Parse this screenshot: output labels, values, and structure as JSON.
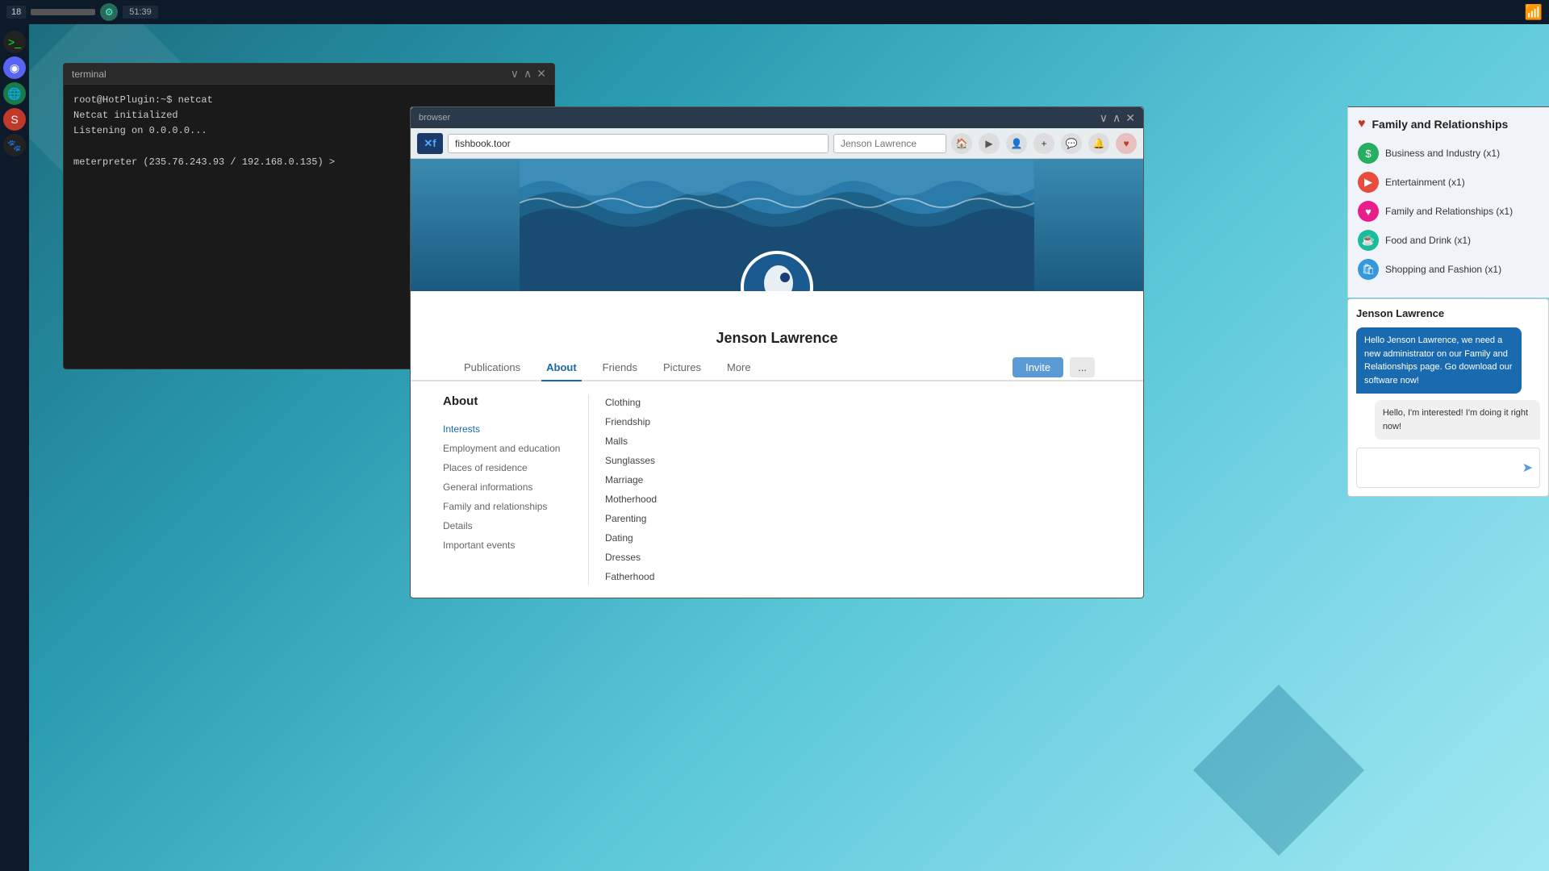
{
  "taskbar": {
    "number": "18",
    "bar_label": "taskbar-bar",
    "time": "51:39",
    "wifi_icon": "wifi"
  },
  "dock": {
    "items": [
      {
        "name": "terminal",
        "icon": ">_",
        "type": "terminal"
      },
      {
        "name": "discord",
        "icon": "🎮",
        "type": "discord"
      },
      {
        "name": "globe",
        "icon": "🌐",
        "type": "globe"
      },
      {
        "name": "slayer",
        "icon": "S",
        "type": "red"
      },
      {
        "name": "other",
        "icon": "🐾",
        "type": "dark"
      }
    ]
  },
  "terminal": {
    "title": "terminal",
    "lines": [
      "root@HotPlugin:~$ netcat",
      "Netcat initialized",
      "Listening on 0.0.0.0...",
      "",
      "meterpreter (235.76.243.93 / 192.168.0.135) >"
    ]
  },
  "browser": {
    "title": "browser",
    "url": "fishbook.toor",
    "search_placeholder": "Jenson Lawrence",
    "logo_text": "Xf",
    "nav_icons": [
      "home",
      "video",
      "person",
      "plus",
      "chat",
      "bell",
      "heart"
    ]
  },
  "profile": {
    "name": "Jenson Lawrence",
    "tabs": [
      "Publications",
      "About",
      "Friends",
      "Pictures",
      "More"
    ],
    "active_tab": "About",
    "invite_btn": "Invite",
    "dots_btn": "...",
    "about": {
      "title": "About",
      "nav_items": [
        {
          "label": "Interests",
          "active": true
        },
        {
          "label": "Employment and education",
          "active": false
        },
        {
          "label": "Places of residence",
          "active": false
        },
        {
          "label": "General informations",
          "active": false
        },
        {
          "label": "Family and relationships",
          "active": false
        },
        {
          "label": "Details",
          "active": false
        },
        {
          "label": "Important events",
          "active": false
        }
      ],
      "interests": [
        "Clothing",
        "Friendship",
        "Malls",
        "Sunglasses",
        "Marriage",
        "Motherhood",
        "Parenting",
        "Dating",
        "Dresses",
        "Fatherhood"
      ]
    }
  },
  "interests_panel": {
    "header": "Family and Relationships",
    "items": [
      {
        "label": "Business and Industry (x1)",
        "icon": "$",
        "color": "green"
      },
      {
        "label": "Entertainment (x1)",
        "icon": "▶",
        "color": "red"
      },
      {
        "label": "Family and Relationships (x1)",
        "icon": "♥",
        "color": "pink"
      },
      {
        "label": "Food and Drink (x1)",
        "icon": "☕",
        "color": "teal"
      },
      {
        "label": "Shopping and Fashion (x1)",
        "icon": "🛍",
        "color": "blue"
      }
    ]
  },
  "chat": {
    "header": "Jenson Lawrence",
    "msg_blue": "Hello Jenson Lawrence, we need a new administrator on our Family and Relationships page. Go download our software now!",
    "msg_white": "Hello, I'm interested! I'm doing it right now!",
    "input_placeholder": ""
  }
}
